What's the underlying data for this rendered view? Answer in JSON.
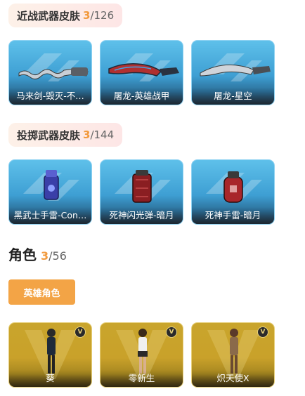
{
  "melee": {
    "title": "近战武器皮肤",
    "owned": "3",
    "total": "/126",
    "items": [
      {
        "label": "马来剑-毁灭-不…"
      },
      {
        "label": "屠龙-英雄战甲"
      },
      {
        "label": "屠龙-星空"
      }
    ]
  },
  "throw": {
    "title": "投掷武器皮肤",
    "owned": "3",
    "total": "/144",
    "items": [
      {
        "label": "黑武士手雷-Con…"
      },
      {
        "label": "死神闪光弹-暗月"
      },
      {
        "label": "死神手雷-暗月"
      }
    ]
  },
  "role": {
    "title": "角色",
    "owned": "3",
    "total": "/56",
    "filter_button": "英雄角色",
    "badge": "V",
    "items": [
      {
        "label": "葵"
      },
      {
        "label": "零新生"
      },
      {
        "label": "炽天使X"
      }
    ]
  },
  "colors": {
    "accent": "#f29a3d",
    "blue_card": "#3e9fd3",
    "gold_card": "#c9a12a"
  }
}
